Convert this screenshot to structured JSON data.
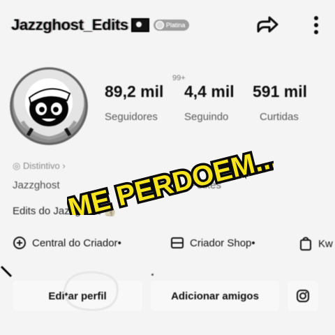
{
  "header": {
    "username": "Jazzghost_Edits",
    "badge_label": "Platina"
  },
  "stats": [
    {
      "value": "89,2 mil",
      "label": "Seguidores"
    },
    {
      "value": "4,4 mil",
      "label": "Seguindo",
      "superscript": "99+"
    },
    {
      "value": "591 mil",
      "label": "Curtidas"
    }
  ],
  "profile": {
    "distintivo": "Distintivo",
    "nickname": "Jazzghost",
    "peixes": "Peixes",
    "bio": "Edits do Jazzghost 👍"
  },
  "overlay": {
    "text": "ME PERDOEM...",
    "fill_color": "#f6e41d",
    "stroke_color": "#0b0b0b"
  },
  "links": [
    {
      "label": "Central do Criador",
      "icon": "plus-circle-icon"
    },
    {
      "label": "Criador Shop",
      "icon": "shop-icon"
    },
    {
      "label": "Kw",
      "icon": "bag-icon"
    }
  ],
  "buttons": {
    "edit_profile": "Editar perfil",
    "add_friends": "Adicionar amigos",
    "instagram_icon": "instagram-icon"
  }
}
